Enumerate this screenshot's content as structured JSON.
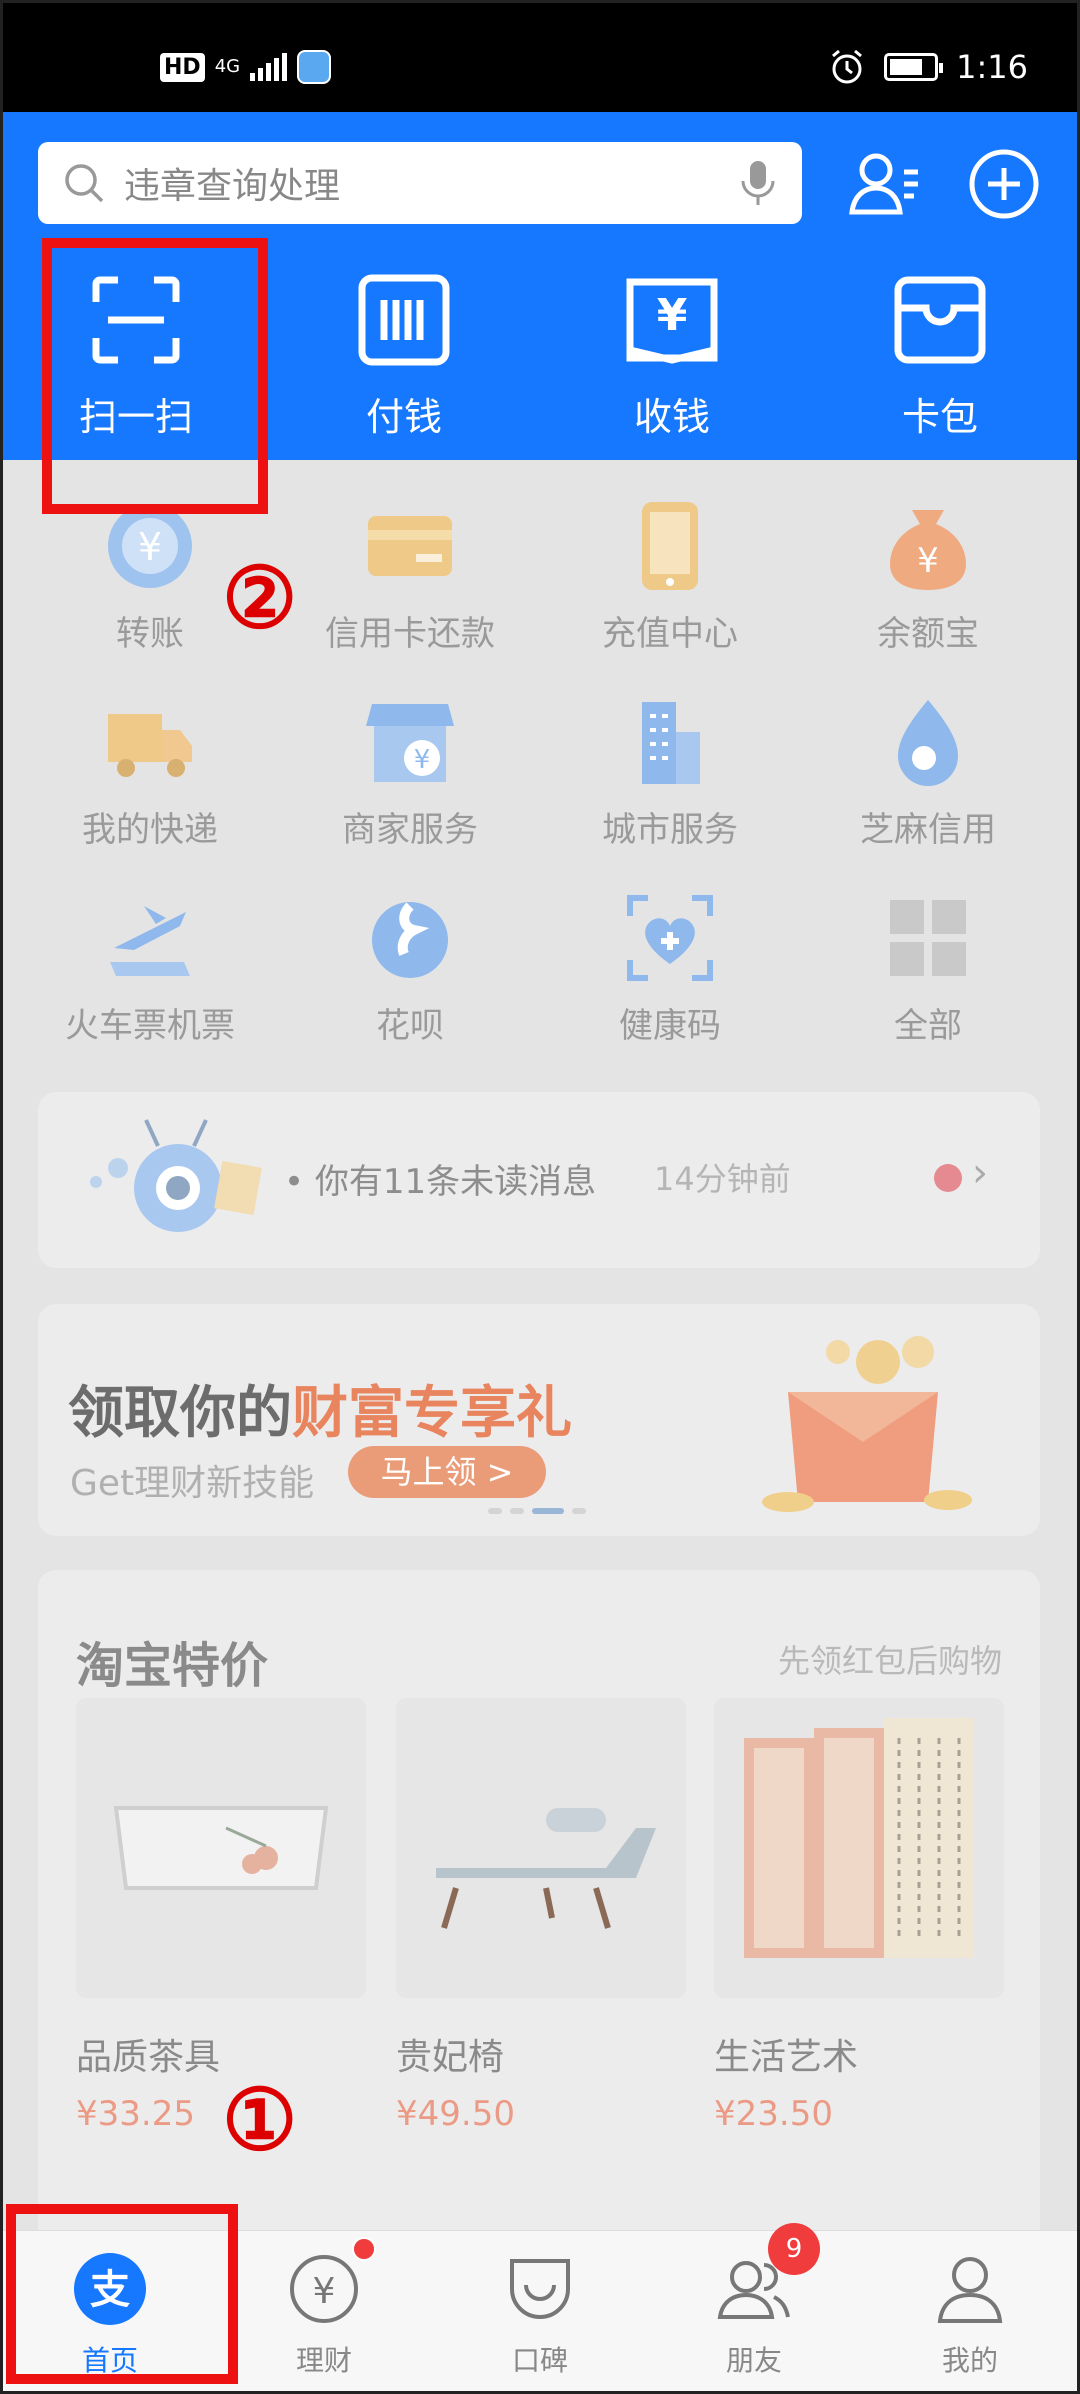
{
  "status_bar": {
    "hd": "HD",
    "network": "4G",
    "time": "1:16"
  },
  "header": {
    "search_placeholder": "违章查询处理",
    "quick_actions": [
      {
        "label": "扫一扫",
        "icon": "scan-icon"
      },
      {
        "label": "付钱",
        "icon": "barcode-icon"
      },
      {
        "label": "收钱",
        "icon": "yuan-receive-icon"
      },
      {
        "label": "卡包",
        "icon": "wallet-icon"
      }
    ]
  },
  "services": [
    {
      "label": "转账",
      "icon": "transfer-icon"
    },
    {
      "label": "信用卡还款",
      "icon": "credit-card-icon"
    },
    {
      "label": "充值中心",
      "icon": "phone-recharge-icon"
    },
    {
      "label": "余额宝",
      "icon": "money-bag-icon"
    },
    {
      "label": "我的快递",
      "icon": "delivery-truck-icon"
    },
    {
      "label": "商家服务",
      "icon": "merchant-store-icon"
    },
    {
      "label": "城市服务",
      "icon": "city-building-icon"
    },
    {
      "label": "芝麻信用",
      "icon": "sesame-credit-icon"
    },
    {
      "label": "火车票机票",
      "icon": "plane-ticket-icon"
    },
    {
      "label": "花呗",
      "icon": "huabei-icon"
    },
    {
      "label": "健康码",
      "icon": "health-code-icon"
    },
    {
      "label": "全部",
      "icon": "grid-all-icon"
    }
  ],
  "notice": {
    "text": "• 你有11条未读消息",
    "time": "14分钟前"
  },
  "banner": {
    "title_plain": "领取你的",
    "title_highlight": "财富专享礼",
    "subtitle": "Get理财新技能",
    "button": "马上领 >"
  },
  "taobao": {
    "title": "淘宝特价",
    "hint": "先领红包后购物",
    "products": [
      {
        "name": "品质茶具",
        "price": "¥33.25"
      },
      {
        "name": "贵妃椅",
        "price": "¥49.50"
      },
      {
        "name": "生活艺术",
        "price": "¥23.50"
      }
    ]
  },
  "tabs": [
    {
      "label": "首页",
      "icon": "alipay-home-icon",
      "active": true
    },
    {
      "label": "理财",
      "icon": "yuan-coin-icon",
      "badge": "dot"
    },
    {
      "label": "口碑",
      "icon": "koubei-icon"
    },
    {
      "label": "朋友",
      "icon": "friends-icon",
      "badge": "9"
    },
    {
      "label": "我的",
      "icon": "profile-icon"
    }
  ],
  "annotations": {
    "marker_1": "①",
    "marker_2": "②"
  },
  "colors": {
    "brand_blue": "#1677ff",
    "annotation_red": "#ee1111"
  }
}
